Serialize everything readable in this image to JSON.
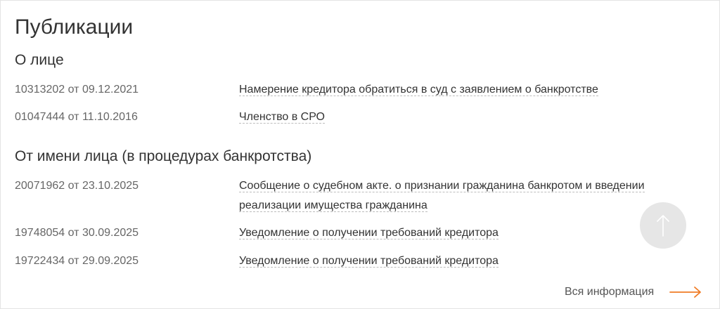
{
  "page": {
    "title": "Публикации"
  },
  "sections": [
    {
      "title": "О лице",
      "items": [
        {
          "id": "10313202 от 09.12.2021",
          "link": "Намерение кредитора обратиться в суд с заявлением о банкротстве"
        },
        {
          "id": "01047444 от 11.10.2016",
          "link": "Членство в СРО"
        }
      ]
    },
    {
      "title": "От имени лица (в процедурах банкротства)",
      "items": [
        {
          "id": "20071962 от 23.10.2025",
          "link": "Сообщение о судебном акте. о признании гражданина банкротом и введении реализации имущества гражданина"
        },
        {
          "id": "19748054 от 30.09.2025",
          "link": "Уведомление о получении требований кредитора"
        },
        {
          "id": "19722434 от 29.09.2025",
          "link": "Уведомление о получении требований кредитора"
        }
      ]
    }
  ],
  "footer": {
    "all_info_label": "Вся информация"
  },
  "colors": {
    "accent": "#f07c26",
    "scroll_button": "#e6e6e6"
  },
  "icons": {
    "scroll_top": "arrow-up-icon",
    "all_info": "arrow-right-icon"
  }
}
